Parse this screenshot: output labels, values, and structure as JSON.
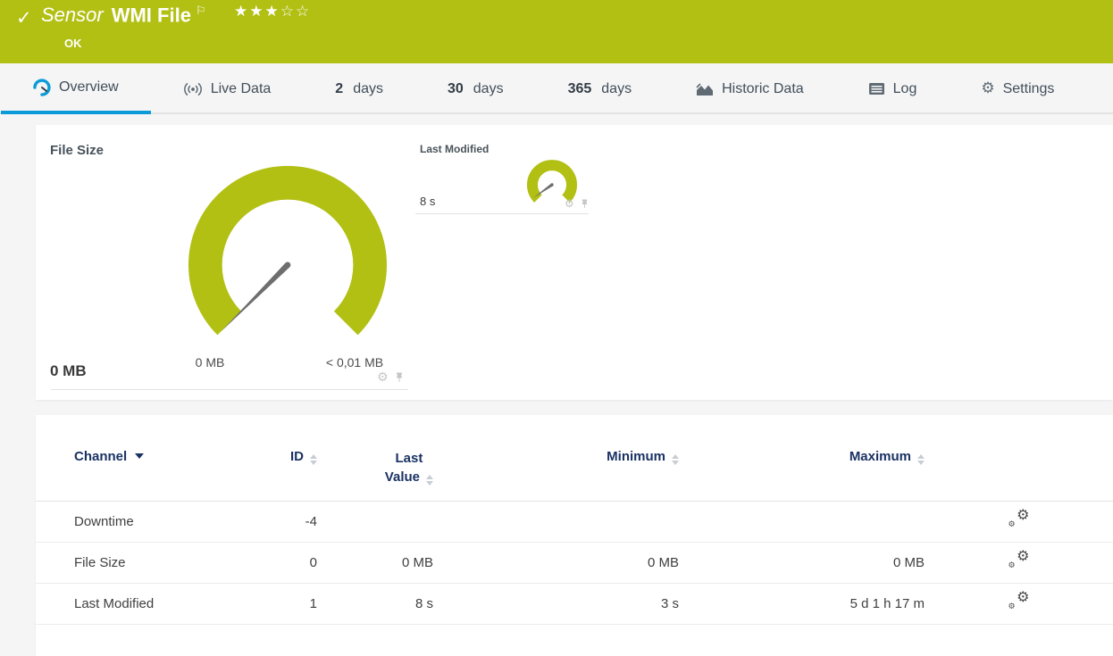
{
  "banner": {
    "kind": "Sensor",
    "title": "WMI File",
    "status": "OK",
    "stars_filled": "★★★",
    "stars_empty": "☆☆"
  },
  "icons": {
    "check": "✓",
    "flag": "⚐",
    "gear": "⚙"
  },
  "tabs": {
    "overview": "Overview",
    "live_data": "Live Data",
    "d2_num": "2",
    "d2_label": "days",
    "d30_num": "30",
    "d30_label": "days",
    "d365_num": "365",
    "d365_label": "days",
    "historic": "Historic Data",
    "log": "Log",
    "settings": "Settings"
  },
  "gauges": {
    "primary": {
      "title": "File Size",
      "value": "0 MB",
      "min_label": "0 MB",
      "max_label": "< 0,01 MB"
    },
    "secondary": {
      "title": "Last Modified",
      "value": "8 s"
    }
  },
  "table": {
    "headers": {
      "channel": "Channel",
      "id": "ID",
      "last_line1": "Last",
      "last_line2": "Value",
      "minimum": "Minimum",
      "maximum": "Maximum"
    },
    "rows": [
      {
        "channel": "Downtime",
        "id": "-4",
        "last": "",
        "min": "",
        "max": ""
      },
      {
        "channel": "File Size",
        "id": "0",
        "last": "0 MB",
        "min": "0 MB",
        "max": "0 MB"
      },
      {
        "channel": "Last Modified",
        "id": "1",
        "last": "8 s",
        "min": "3 s",
        "max": "5 d 1 h 17 m"
      }
    ]
  },
  "colors": {
    "brand_green": "#b2c014",
    "accent_blue": "#0c9bd8",
    "header_navy": "#1a3263",
    "needle_gray": "#6e6e6e"
  }
}
